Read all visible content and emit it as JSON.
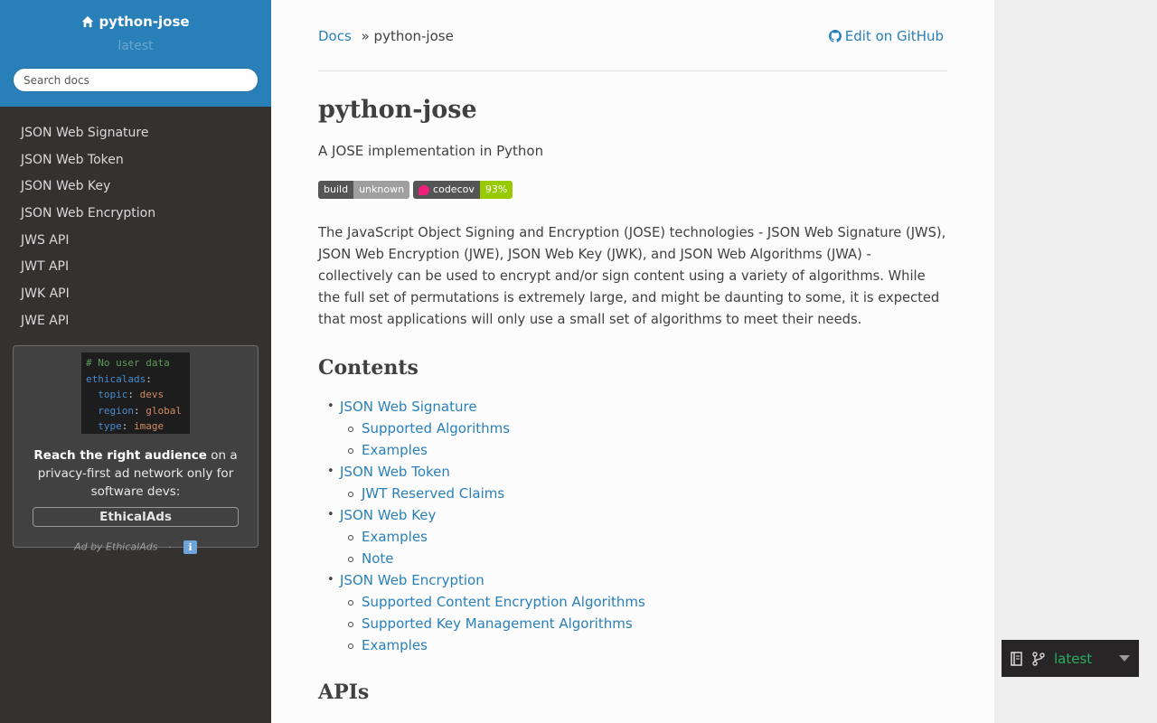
{
  "sidebar": {
    "project_name": "python-jose",
    "version": "latest",
    "search_placeholder": "Search docs",
    "nav": [
      "JSON Web Signature",
      "JSON Web Token",
      "JSON Web Key",
      "JSON Web Encryption",
      "JWS API",
      "JWT API",
      "JWK API",
      "JWE API"
    ]
  },
  "ad": {
    "code": {
      "comment": "# No user data",
      "root_key": "ethicalads",
      "lines": [
        {
          "key": "topic",
          "value": "devs"
        },
        {
          "key": "region",
          "value": "global"
        },
        {
          "key": "type",
          "value": "image"
        }
      ]
    },
    "headline_bold": "Reach the right audience",
    "headline_rest": " on a privacy-first ad network only for software devs:",
    "button": "EthicalAds",
    "footer": "Ad by EthicalAds",
    "footer_sep": "·",
    "info_icon": "ℹ"
  },
  "breadcrumb": {
    "root": "Docs",
    "separator": "»",
    "current": "python-jose",
    "edit": "Edit on GitHub"
  },
  "page": {
    "title": "python-jose",
    "tagline": "A JOSE implementation in Python",
    "badges": [
      {
        "left": "build",
        "right": "unknown",
        "right_color": "#9f9f9f",
        "icon": ""
      },
      {
        "left": "codecov",
        "right": "93%",
        "right_color": "#97ca00",
        "icon": "codecov-icon"
      }
    ],
    "intro": "The JavaScript Object Signing and Encryption (JOSE) technologies - JSON Web Signature (JWS), JSON Web Encryption (JWE), JSON Web Key (JWK), and JSON Web Algorithms (JWA) - collectively can be used to encrypt and/or sign content using a variety of algorithms. While the full set of permutations is extremely large, and might be daunting to some, it is expected that most applications will only use a small set of algorithms to meet their needs.",
    "contents_heading": "Contents",
    "toc": [
      {
        "label": "JSON Web Signature",
        "children": [
          "Supported Algorithms",
          "Examples"
        ]
      },
      {
        "label": "JSON Web Token",
        "children": [
          "JWT Reserved Claims"
        ]
      },
      {
        "label": "JSON Web Key",
        "children": [
          "Examples",
          "Note"
        ]
      },
      {
        "label": "JSON Web Encryption",
        "children": [
          "Supported Content Encryption Algorithms",
          "Supported Key Management Algorithms",
          "Examples"
        ]
      }
    ],
    "apis_heading": "APIs"
  },
  "flyout": {
    "version": "latest"
  },
  "colors": {
    "accent": "#2980b9",
    "sidebar_bg": "#343131",
    "flyout_version": "#27ae60"
  }
}
